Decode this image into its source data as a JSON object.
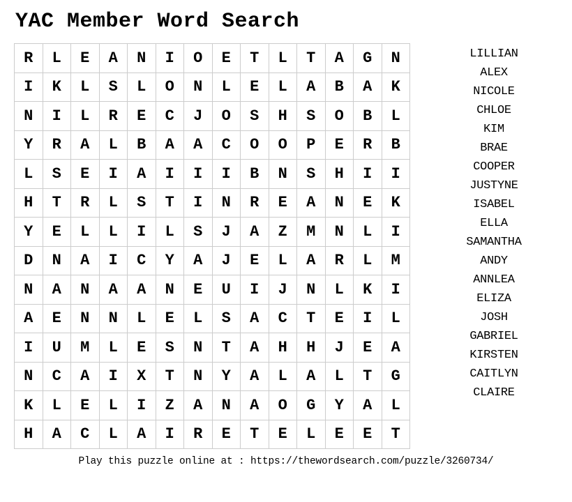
{
  "title": "YAC Member Word Search",
  "grid": [
    [
      "R",
      "L",
      "E",
      "A",
      "N",
      "I",
      "O",
      "E",
      "T",
      "L",
      "T",
      "A",
      "G",
      "N"
    ],
    [
      "I",
      "K",
      "L",
      "S",
      "L",
      "O",
      "N",
      "L",
      "E",
      "L",
      "A",
      "B",
      "A",
      "K"
    ],
    [
      "N",
      "I",
      "L",
      "R",
      "E",
      "C",
      "J",
      "O",
      "S",
      "H",
      "S",
      "O",
      "B",
      "L"
    ],
    [
      "Y",
      "R",
      "A",
      "L",
      "B",
      "A",
      "A",
      "C",
      "O",
      "O",
      "P",
      "E",
      "R",
      "B"
    ],
    [
      "L",
      "S",
      "E",
      "I",
      "A",
      "I",
      "I",
      "I",
      "B",
      "N",
      "S",
      "H",
      "I",
      "I"
    ],
    [
      "H",
      "T",
      "R",
      "L",
      "S",
      "T",
      "I",
      "N",
      "R",
      "E",
      "A",
      "N",
      "E",
      "K"
    ],
    [
      "Y",
      "E",
      "L",
      "L",
      "I",
      "L",
      "S",
      "J",
      "A",
      "Z",
      "M",
      "N",
      "L",
      "I"
    ],
    [
      "D",
      "N",
      "A",
      "I",
      "C",
      "Y",
      "A",
      "J",
      "E",
      "L",
      "A",
      "R",
      "L",
      "M"
    ],
    [
      "N",
      "A",
      "N",
      "A",
      "A",
      "N",
      "E",
      "U",
      "I",
      "J",
      "N",
      "L",
      "K",
      "I"
    ],
    [
      "A",
      "E",
      "N",
      "N",
      "L",
      "E",
      "L",
      "S",
      "A",
      "C",
      "T",
      "E",
      "I",
      "L"
    ],
    [
      "I",
      "U",
      "M",
      "L",
      "E",
      "S",
      "N",
      "T",
      "A",
      "H",
      "H",
      "J",
      "E",
      "A"
    ],
    [
      "N",
      "C",
      "A",
      "I",
      "X",
      "T",
      "N",
      "Y",
      "A",
      "L",
      "A",
      "L",
      "T",
      "G"
    ],
    [
      "K",
      "L",
      "E",
      "L",
      "I",
      "Z",
      "A",
      "N",
      "A",
      "O",
      "G",
      "Y",
      "A",
      "L"
    ],
    [
      "H",
      "A",
      "C",
      "L",
      "A",
      "I",
      "R",
      "E",
      "T",
      "E",
      "L",
      "E",
      "E",
      "T"
    ]
  ],
  "words": [
    "LILLIAN",
    "ALEX",
    "NICOLE",
    "CHLOE",
    "KIM",
    "BRAE",
    "COOPER",
    "JUSTYNE",
    "ISABEL",
    "ELLA",
    "SAMANTHA",
    "ANDY",
    "ANNLEA",
    "ELIZA",
    "JOSH",
    "GABRIEL",
    "KIRSTEN",
    "CAITLYN",
    "CLAIRE"
  ],
  "footer": "Play this puzzle online at : https://thewordsearch.com/puzzle/3260734/"
}
